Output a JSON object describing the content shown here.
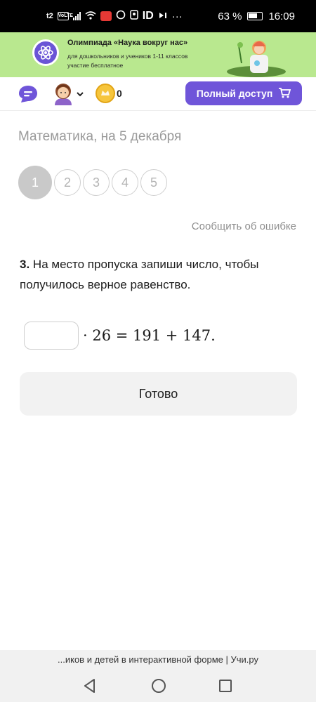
{
  "status_bar": {
    "carrier": "t2",
    "volte": "VoLTE",
    "id_label": "ID",
    "more": "···",
    "battery_percent": "63 %",
    "time": "16:09"
  },
  "banner": {
    "title": "Олимпиада «Наука вокруг нас»",
    "subtitle_line1": "для дошкольников и учеников 1-11 классов",
    "subtitle_line2": "участие бесплатное"
  },
  "header": {
    "coin_count": "0",
    "full_access_label": "Полный доступ"
  },
  "page": {
    "title": "Математика, на 5 декабря",
    "steps": [
      "1",
      "2",
      "3",
      "4",
      "5"
    ],
    "active_step": 0,
    "report_error": "Сообщить об ошибке"
  },
  "question": {
    "number": "3.",
    "text": "На место пропуска запиши число, чтобы получилось верное равенство.",
    "answer_value": "",
    "equation_tail": "· 26 = 191 + 147."
  },
  "done_button": "Готово",
  "browser": {
    "url_text": "...иков и детей в интерактивной форме | Учи.ру"
  },
  "colors": {
    "accent": "#6f55d9",
    "banner_bg": "#b9e88f",
    "coin": "#f6c53c"
  }
}
